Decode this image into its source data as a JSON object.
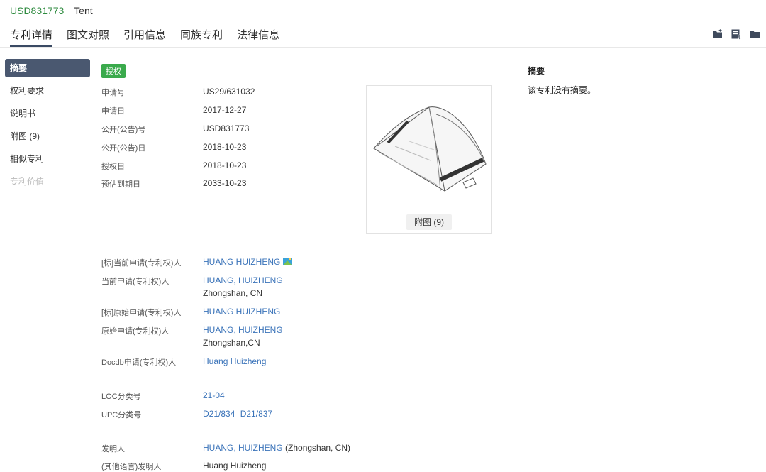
{
  "header": {
    "patent_number": "USD831773",
    "title": "Tent",
    "tabs": [
      {
        "label": "专利详情",
        "active": true
      },
      {
        "label": "图文对照"
      },
      {
        "label": "引用信息"
      },
      {
        "label": "同族专利"
      },
      {
        "label": "法律信息"
      }
    ],
    "icons": [
      "folder-share-icon",
      "export-icon",
      "folder-icon"
    ]
  },
  "sidebar": {
    "items": [
      {
        "label": "摘要",
        "active": true
      },
      {
        "label": "权利要求"
      },
      {
        "label": "说明书"
      },
      {
        "label": "附图 (9)"
      },
      {
        "label": "相似专利"
      },
      {
        "label": "专利价值",
        "disabled": true
      }
    ]
  },
  "status_badge": "授权",
  "basic": {
    "application_no": {
      "label": "申请号",
      "value": "US29/631032"
    },
    "application_date": {
      "label": "申请日",
      "value": "2017-12-27"
    },
    "publication_no": {
      "label": "公开(公告)号",
      "value": "USD831773"
    },
    "publication_date": {
      "label": "公开(公告)日",
      "value": "2018-10-23"
    },
    "grant_date": {
      "label": "授权日",
      "value": "2018-10-23"
    },
    "expiry_date": {
      "label": "预估到期日",
      "value": "2033-10-23"
    }
  },
  "figure": {
    "button_label": "附图 (9)"
  },
  "parties": {
    "std_current_applicant": {
      "label": "[标]当前申请(专利权)人",
      "value": "HUANG HUIZHENG"
    },
    "current_applicant": {
      "label": "当前申请(专利权)人",
      "value": "HUANG, HUIZHENG",
      "location": "Zhongshan, CN"
    },
    "std_original_applicant": {
      "label": "[标]原始申请(专利权)人",
      "value": "HUANG HUIZHENG"
    },
    "original_applicant": {
      "label": "原始申请(专利权)人",
      "value": "HUANG, HUIZHENG",
      "location": "Zhongshan,CN"
    },
    "docdb_applicant": {
      "label": "Docdb申请(专利权)人",
      "value": "Huang Huizheng"
    }
  },
  "classification": {
    "loc": {
      "label": "LOC分类号",
      "value": "21-04"
    },
    "upc": {
      "label": "UPC分类号",
      "value1": "D21/834",
      "value2": "D21/837"
    }
  },
  "inventors": {
    "inventor": {
      "label": "发明人",
      "value": "HUANG, HUIZHENG",
      "location": "(Zhongshan, CN)"
    },
    "other_lang_inventor": {
      "label": "(其他语言)发明人",
      "value": "Huang Huizheng"
    }
  },
  "abstract": {
    "heading": "摘要",
    "text": "该专利没有摘要。"
  }
}
